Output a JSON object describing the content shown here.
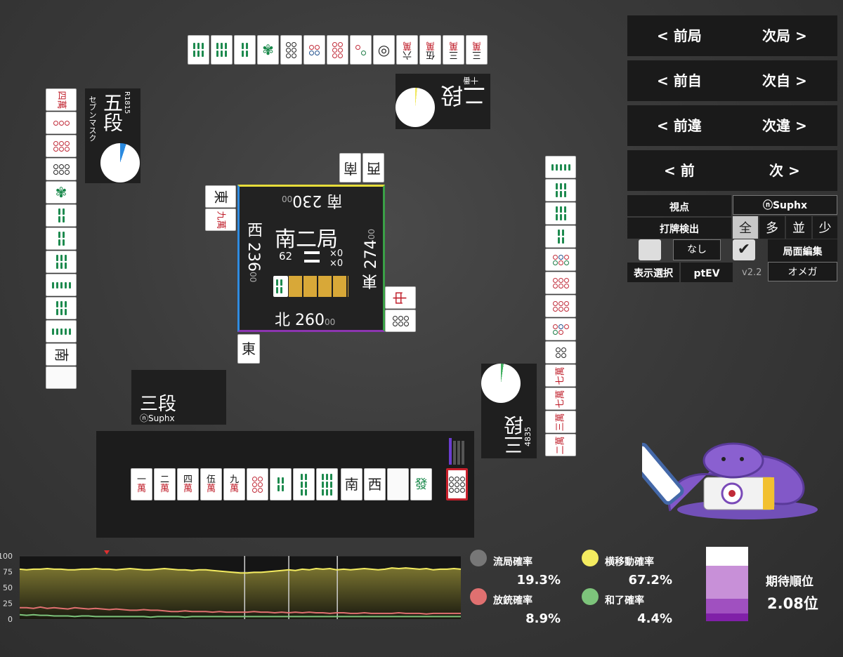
{
  "nav": {
    "prev_round": "< 前局",
    "next_round": "次局 >",
    "prev_self": "< 前自",
    "next_self": "次自 >",
    "prev_diff": "< 前違",
    "next_diff": "次違 >",
    "prev": "< 前",
    "next": "次 >"
  },
  "controls": {
    "viewpoint_label": "視点",
    "viewpoint_value": "ⓝSuphx",
    "discard_detect_label": "打牌検出",
    "filters": [
      "全",
      "多",
      "並",
      "少"
    ],
    "none_button": "なし",
    "board_edit": "局面編集",
    "display_select": "表示選択",
    "display_value": "ptEV",
    "version": "v2.2",
    "ai_select": "オメガ"
  },
  "center": {
    "round": "南二局",
    "honba": "62",
    "counters": [
      "×0",
      "×0"
    ],
    "score_top": {
      "seat": "南",
      "value": "230",
      "suffix": "00"
    },
    "score_left": {
      "seat": "西",
      "value": "236",
      "suffix": "00"
    },
    "score_right": {
      "seat": "東",
      "value": "274",
      "suffix": "00"
    },
    "score_bottom": {
      "seat": "北",
      "value": "260",
      "suffix": "00"
    }
  },
  "players": {
    "top": {
      "rank": "二段",
      "name": "十番"
    },
    "left": {
      "rank": "五段",
      "name": "セブンマスク",
      "rate": "R1815"
    },
    "right": {
      "rank": "三段",
      "rate": "4835"
    },
    "bottom": {
      "rank": "三段",
      "name": "ⓝSuphx"
    }
  },
  "hand": {
    "tiles": [
      {
        "top": "一",
        "bottom": "萬"
      },
      {
        "top": "二",
        "bottom": "萬"
      },
      {
        "top": "四",
        "bottom": "萬"
      },
      {
        "top": "伍",
        "bottom": "萬"
      },
      {
        "top": "九",
        "bottom": "萬"
      }
    ],
    "honors": [
      "南",
      "西",
      "",
      "發"
    ]
  },
  "stats": {
    "ryukyoku_label": "流局確率",
    "ryukyoku_value": "19.3%",
    "yokoido_label": "横移動確率",
    "yokoido_value": "67.2%",
    "houju_label": "放銃確率",
    "houju_value": "8.9%",
    "hora_label": "和了確率",
    "hora_value": "4.4%",
    "expected_rank_label": "期待順位",
    "expected_rank_value": "2.08位"
  },
  "chart_data": {
    "type": "line",
    "y_ticks": [
      "100",
      "75",
      "50",
      "25",
      "0"
    ],
    "ylim": [
      0,
      100
    ],
    "series": [
      {
        "name": "横移動確率",
        "color": "#f4ec60",
        "values": [
          79,
          78,
          79,
          79,
          80,
          79,
          79,
          78,
          78,
          79,
          79,
          80,
          79,
          79,
          78,
          79,
          80,
          79,
          78,
          78,
          79,
          80,
          79,
          78,
          78,
          77,
          78,
          78,
          77,
          76,
          75,
          74,
          73,
          73,
          74,
          74,
          75,
          76,
          77,
          78,
          77,
          79,
          78,
          80,
          79,
          80,
          78,
          79,
          78,
          79,
          80,
          79,
          78,
          79,
          81,
          80,
          81,
          80,
          79,
          80,
          78,
          79,
          79,
          80,
          79
        ]
      },
      {
        "name": "放銃確率",
        "color": "#e07070",
        "values": [
          18,
          18,
          17,
          19,
          17,
          18,
          17,
          16,
          18,
          17,
          16,
          17,
          16,
          15,
          16,
          15,
          14,
          14,
          15,
          14,
          14,
          13,
          12,
          12,
          13,
          12,
          12,
          12,
          11,
          12,
          11,
          11,
          11,
          11,
          12,
          11,
          11,
          10,
          11,
          10,
          11,
          10,
          11,
          10,
          10,
          9,
          10,
          10,
          9,
          9,
          10,
          9,
          9,
          9,
          9,
          10,
          9,
          9,
          9,
          8,
          9,
          9,
          9,
          9,
          9
        ]
      },
      {
        "name": "和了確率",
        "color": "#7dc47b",
        "values": [
          7,
          6,
          7,
          6,
          6,
          5,
          5,
          5,
          4,
          5,
          5,
          4,
          4,
          4,
          4,
          4,
          4,
          4,
          4,
          3,
          4,
          4,
          4,
          4,
          3,
          4,
          4,
          4,
          4,
          4,
          4,
          4,
          4,
          4,
          4,
          4,
          4,
          4,
          4,
          4,
          4,
          4,
          4,
          4,
          4,
          4,
          4,
          4,
          4,
          4,
          4,
          4,
          4,
          4,
          4,
          4,
          4,
          4,
          4,
          4,
          4,
          4,
          4,
          4,
          4
        ]
      }
    ],
    "markers_x": [
      0.51,
      0.61,
      0.72
    ],
    "rank_bar": [
      25,
      45,
      20,
      10
    ]
  }
}
